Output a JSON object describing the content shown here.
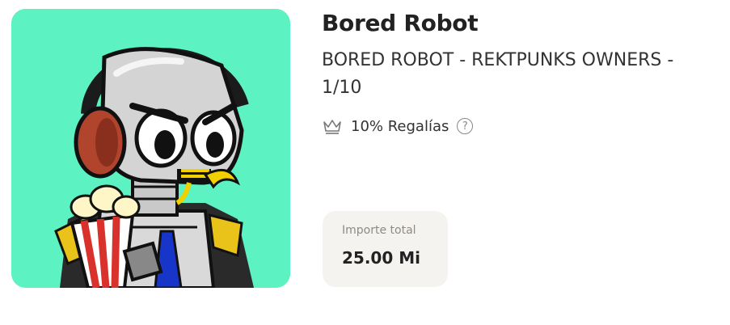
{
  "nft": {
    "title": "Bored Robot",
    "subtitle": "BORED ROBOT - REKTPUNKS OWNERS - 1/10",
    "image_background": "#5cf2c2"
  },
  "royalty": {
    "icon": "crown-icon",
    "label": "10% Regalías",
    "help_icon": "help-icon",
    "help_glyph": "?"
  },
  "total": {
    "label": "Importe total",
    "value": "25.00 Mi"
  }
}
